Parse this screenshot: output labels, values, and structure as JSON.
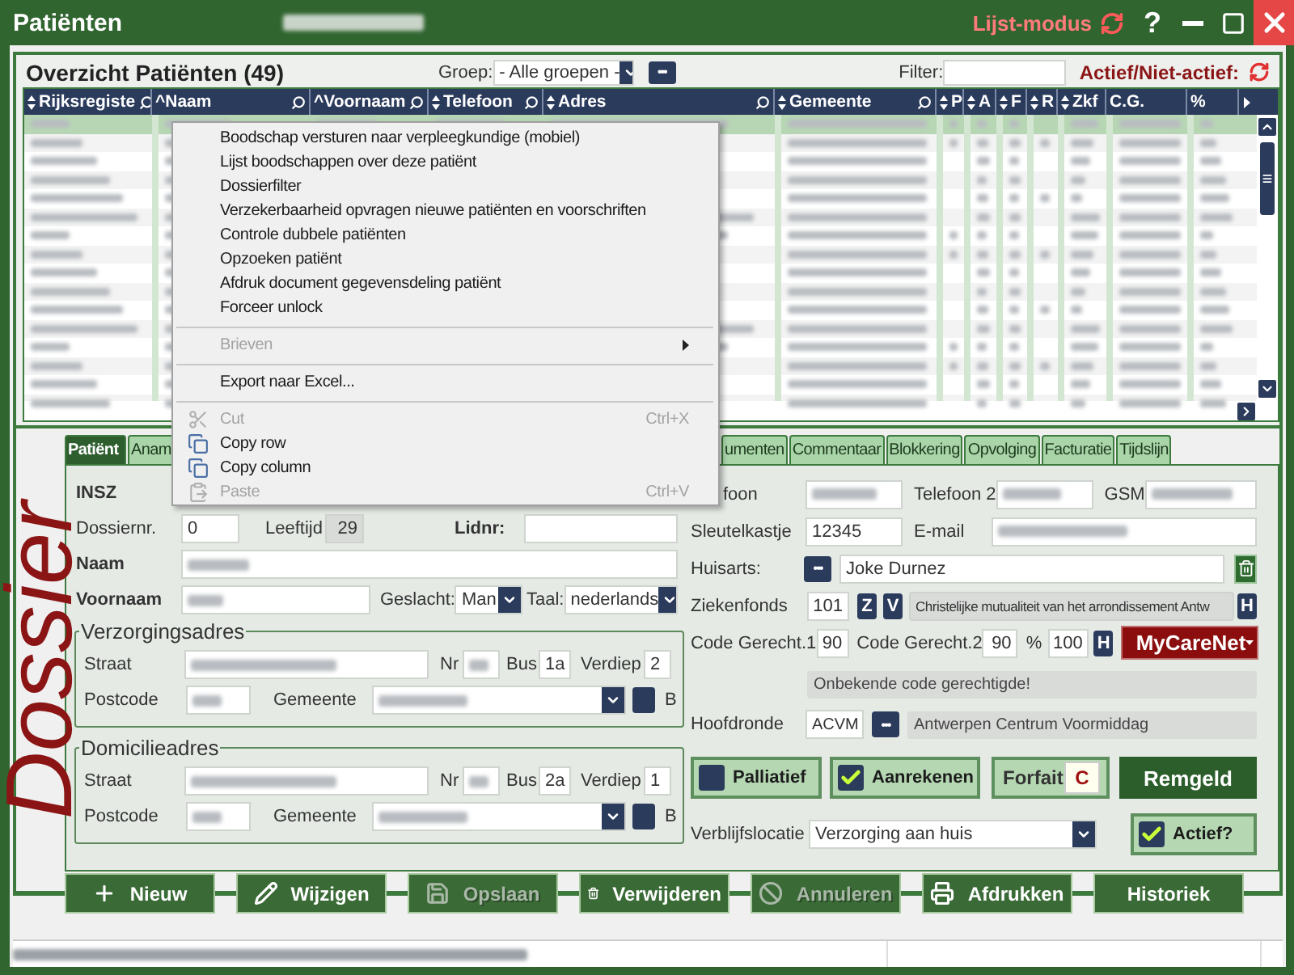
{
  "title_bar": {
    "title": "Patiënten",
    "mode": "Lijst-modus",
    "help": "?"
  },
  "list_header": {
    "title": "Overzicht Patiënten (49)",
    "group_label": "Groep:",
    "group_value": "- Alle groepen -",
    "more_button": "•••",
    "filter_label": "Filter:",
    "active_toggle": "Actief/Niet-actief:"
  },
  "table": {
    "columns": [
      {
        "label": "Rijksregiste",
        "sortable": true,
        "searchable": true
      },
      {
        "label": "^Naam",
        "sortable": false,
        "searchable": true
      },
      {
        "label": "^Voornaam",
        "sortable": false,
        "searchable": true
      },
      {
        "label": "Telefoon",
        "sortable": true,
        "searchable": true
      },
      {
        "label": "Adres",
        "sortable": true,
        "searchable": true
      },
      {
        "label": "Gemeente",
        "sortable": true,
        "searchable": true
      },
      {
        "label": "P",
        "sortable": true,
        "searchable": false
      },
      {
        "label": "A",
        "sortable": true,
        "searchable": false
      },
      {
        "label": "F",
        "sortable": true,
        "searchable": false
      },
      {
        "label": "R",
        "sortable": true,
        "searchable": false
      },
      {
        "label": "Zkf",
        "sortable": true,
        "searchable": false
      },
      {
        "label": "C.G.",
        "sortable": false,
        "searchable": false
      },
      {
        "label": "%",
        "sortable": false,
        "searchable": false
      }
    ],
    "rows": [
      {
        "selected": true
      },
      {
        "selected": false
      },
      {
        "selected": false
      },
      {
        "selected": false
      },
      {
        "selected": false
      },
      {
        "selected": false
      },
      {
        "selected": false
      },
      {
        "selected": false
      },
      {
        "selected": false
      },
      {
        "selected": false
      },
      {
        "selected": false
      },
      {
        "selected": false
      },
      {
        "selected": false
      },
      {
        "selected": false
      },
      {
        "selected": false
      },
      {
        "selected": false
      }
    ]
  },
  "context_menu": [
    {
      "kind": "item",
      "label": "Boodschap versturen naar verpleegkundige (mobiel)",
      "disabled": false
    },
    {
      "kind": "item",
      "label": "Lijst boodschappen over deze patiënt",
      "disabled": false
    },
    {
      "kind": "item",
      "label": "Dossierfilter",
      "disabled": false
    },
    {
      "kind": "item",
      "label": "Verzekerbaarheid opvragen nieuwe patiënten en voorschriften",
      "disabled": false
    },
    {
      "kind": "item",
      "label": "Controle dubbele patiënten",
      "disabled": false
    },
    {
      "kind": "item",
      "label": "Opzoeken patiënt",
      "disabled": false
    },
    {
      "kind": "item",
      "label": "Afdruk document gegevensdeling patiënt",
      "disabled": false
    },
    {
      "kind": "item",
      "label": "Forceer unlock",
      "disabled": false
    },
    {
      "kind": "separator"
    },
    {
      "kind": "submenu",
      "label": "Brieven",
      "disabled": true
    },
    {
      "kind": "separator"
    },
    {
      "kind": "item",
      "label": "Export naar Excel...",
      "disabled": false
    },
    {
      "kind": "separator"
    },
    {
      "kind": "edit",
      "label": "Cut",
      "shortcut": "Ctrl+X",
      "disabled": true
    },
    {
      "kind": "edit",
      "label": "Copy row",
      "disabled": false
    },
    {
      "kind": "edit",
      "label": "Copy column",
      "disabled": false
    },
    {
      "kind": "edit",
      "label": "Paste",
      "shortcut": "Ctrl+V",
      "disabled": true
    }
  ],
  "dossier_label": "Dossier",
  "tabs_left": [
    {
      "label": "Patiënt",
      "selected": true
    },
    {
      "label": "Anam",
      "selected": false
    }
  ],
  "tabs_right": [
    {
      "label": "umenten",
      "selected": false
    },
    {
      "label": "Commentaar",
      "selected": false
    },
    {
      "label": "Blokkering",
      "selected": false
    },
    {
      "label": "Opvolging",
      "selected": false
    },
    {
      "label": "Facturatie",
      "selected": false
    },
    {
      "label": "Tijdslijn",
      "selected": false
    }
  ],
  "patient_form": {
    "insz_label": "INSZ",
    "dossiernr_label": "Dossiernr.",
    "dossiernr": "0",
    "leeftijd_label": "Leeftijd",
    "leeftijd": "29",
    "lidnr_label": "Lidnr:",
    "naam_label": "Naam",
    "voornaam_label": "Voornaam",
    "geslacht_label": "Geslacht:",
    "geslacht": "Man",
    "taal_label": "Taal:",
    "taal": "nederlands",
    "addresses": [
      {
        "title": "Verzorgingsadres",
        "straat_label": "Straat",
        "nr_label": "Nr",
        "bus_label": "Bus",
        "bus": "1a",
        "verdiep_label": "Verdiep",
        "verdiep": "2",
        "postcode_label": "Postcode",
        "gemeente_label": "Gemeente",
        "b_label": "B"
      },
      {
        "title": "Domicilieadres",
        "straat_label": "Straat",
        "nr_label": "Nr",
        "bus_label": "Bus",
        "bus": "2a",
        "verdiep_label": "Verdiep",
        "verdiep": "1",
        "postcode_label": "Postcode",
        "gemeente_label": "Gemeente",
        "b_label": "B"
      }
    ],
    "telefoon_label": "foon",
    "telefoon2_label": "Telefoon 2",
    "gsm_label": "GSM",
    "sleutelkastje_label": "Sleutelkastje",
    "sleutelkastje": "12345",
    "email_label": "E-mail",
    "huisarts_label": "Huisarts:",
    "huisarts_button": "•••",
    "huisarts": "Joke Durnez",
    "ziekenfonds_label": "Ziekenfonds",
    "ziekenfonds": "101",
    "z_button": "Z",
    "v_button": "V",
    "ziekenfonds_name": "Christelijke mutualiteit van het arrondissement Antw",
    "h_button": "H",
    "cg1_label": "Code Gerecht.1",
    "cg1": "90",
    "cg2_label": "Code Gerecht.2",
    "cg2": "90",
    "pct_label": "%",
    "pct": "100",
    "h2_button": "H",
    "mycarenet": "MyCareNet",
    "cg_message": "Onbekende code gerechtigde!",
    "hoofdronde_label": "Hoofdronde",
    "hoofdronde": "ACVM",
    "hoofdronde_button": "•••",
    "hoofdronde_name": "Antwerpen Centrum Voormiddag",
    "toggles": [
      {
        "label": "Palliatief",
        "checked": false
      },
      {
        "label": "Aanrekenen",
        "checked": true
      }
    ],
    "forfait_label": "Forfait",
    "forfait": "C",
    "remgeld": "Remgeld",
    "verblijfslocatie_label": "Verblijfslocatie",
    "verblijfslocatie": "Verzorging aan huis",
    "actief": {
      "label": "Actief?",
      "checked": true
    }
  },
  "buttons": [
    {
      "label": "Nieuw",
      "disabled": false
    },
    {
      "label": "Wijzigen",
      "disabled": false
    },
    {
      "label": "Opslaan",
      "disabled": true
    },
    {
      "label": "Verwijderen",
      "disabled": false
    },
    {
      "label": "Annuleren",
      "disabled": true
    },
    {
      "label": "Afdrukken",
      "disabled": false
    },
    {
      "label": "Historiek",
      "disabled": false
    }
  ]
}
